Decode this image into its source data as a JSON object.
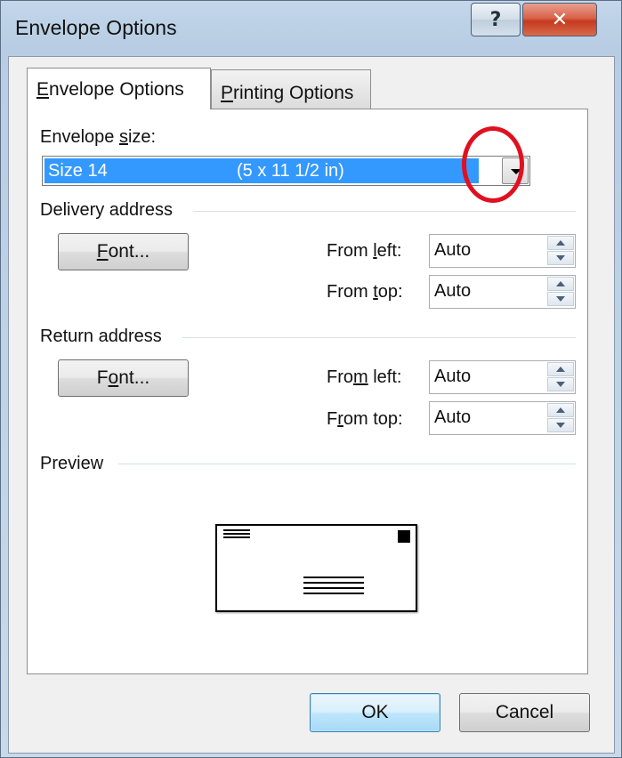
{
  "window": {
    "title": "Envelope Options",
    "help_glyph": "?",
    "close_glyph": "✕"
  },
  "tabs": [
    {
      "label_pre": "",
      "label_u": "E",
      "label_post": "nvelope Options",
      "active": true
    },
    {
      "label_pre": "",
      "label_u": "P",
      "label_post": "rinting Options",
      "active": false
    }
  ],
  "envelope_size": {
    "label_pre": "Envelope ",
    "label_u": "s",
    "label_post": "ize:",
    "selected_name": "Size 14",
    "selected_dims": "(5 x 11 1/2 in)"
  },
  "delivery": {
    "heading": "Delivery address",
    "font_pre": "",
    "font_u": "F",
    "font_post": "ont...",
    "from_left_pre": "From ",
    "from_left_u": "l",
    "from_left_post": "eft:",
    "from_left_value": "Auto",
    "from_top_pre": "From ",
    "from_top_u": "t",
    "from_top_post": "op:",
    "from_top_value": "Auto"
  },
  "return": {
    "heading": "Return address",
    "font_pre": "F",
    "font_u": "o",
    "font_post": "nt...",
    "from_left_pre": "Fro",
    "from_left_u": "m",
    "from_left_post": " left:",
    "from_left_value": "Auto",
    "from_top_pre": "F",
    "from_top_u": "r",
    "from_top_post": "om top:",
    "from_top_value": "Auto"
  },
  "preview": {
    "heading": "Preview"
  },
  "buttons": {
    "ok": "OK",
    "cancel": "Cancel"
  },
  "colors": {
    "selection": "#3399ff",
    "annotation_circle": "#e01020"
  },
  "icons": [
    "help-icon",
    "close-icon",
    "dropdown-arrow-icon",
    "spin-up-icon",
    "spin-down-icon"
  ]
}
